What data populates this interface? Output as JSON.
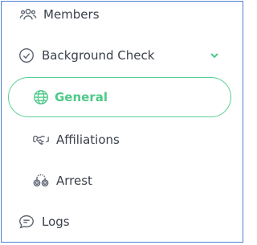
{
  "nav": {
    "members": {
      "label": "Members",
      "icon": "users-icon"
    },
    "background_check": {
      "label": "Background Check",
      "icon": "check-circle-icon",
      "expanded": true
    },
    "sub_items": [
      {
        "label": "General",
        "icon": "globe-icon",
        "active": true
      },
      {
        "label": "Affiliations",
        "icon": "handshake-icon"
      },
      {
        "label": "Arrest",
        "icon": "handcuffs-icon"
      }
    ],
    "logs": {
      "label": "Logs",
      "icon": "chat-bubble-icon"
    }
  },
  "colors": {
    "accent": "#4fc98a",
    "text": "#3a3f4a",
    "icon": "#5b6170",
    "frame": "#4a7fcf"
  }
}
